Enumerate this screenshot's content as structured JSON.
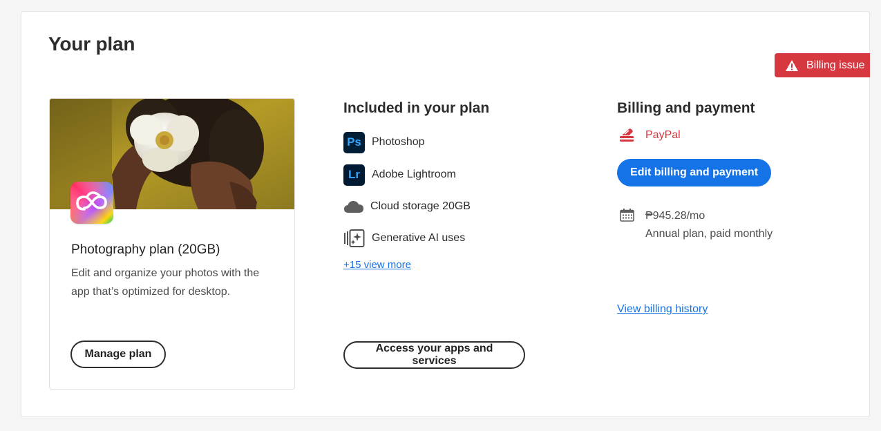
{
  "page": {
    "title": "Your plan"
  },
  "badge": {
    "label": "Billing issue",
    "icon": "warning-icon",
    "color": "#d7373f"
  },
  "plan_card": {
    "name": "Photography plan (20GB)",
    "description": "Edit and organize your photos with the app that’s optimized for desktop.",
    "manage_label": "Manage plan",
    "logo_icon": "creative-cloud-icon"
  },
  "included": {
    "title": "Included in your plan",
    "items": [
      {
        "label": "Photoshop",
        "icon": "photoshop-icon",
        "badge": "Ps"
      },
      {
        "label": "Adobe Lightroom",
        "icon": "lightroom-icon",
        "badge": "Lr"
      },
      {
        "label": "Cloud storage 20GB",
        "icon": "cloud-icon"
      },
      {
        "label": "Generative AI uses",
        "icon": "generative-ai-icon"
      }
    ],
    "view_more": "+15 view more",
    "access_label": "Access your apps and services"
  },
  "billing": {
    "title": "Billing and payment",
    "method": "PayPal",
    "method_icon": "payment-card-icon",
    "edit_label": "Edit billing and payment",
    "price": "₱945.28/mo",
    "term": "Annual plan, paid monthly",
    "calendar_icon": "calendar-icon",
    "history_label": "View billing history"
  },
  "colors": {
    "accent": "#1473e6",
    "error": "#d7373f",
    "text": "#2c2c2c"
  }
}
